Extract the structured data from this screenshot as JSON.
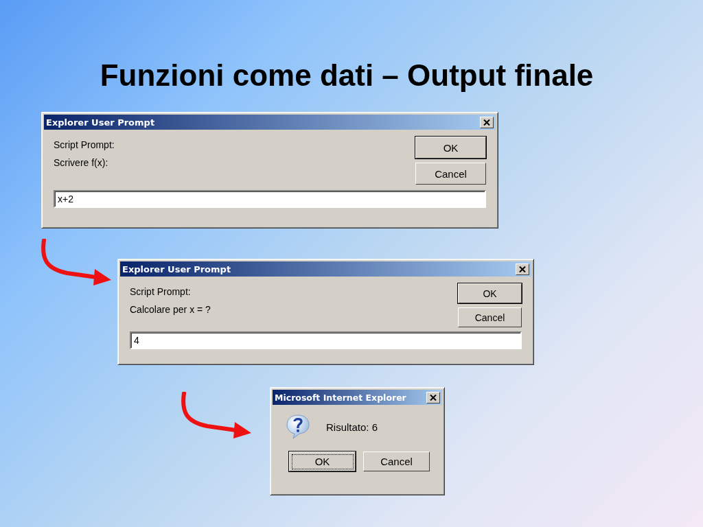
{
  "title": "Funzioni come dati – Output finale",
  "dialogs": [
    {
      "kind": "prompt",
      "title": "Explorer User Prompt",
      "lines": [
        "Script Prompt:",
        "Scrivere f(x):"
      ],
      "input": {
        "value": "x+2"
      },
      "buttons": [
        {
          "label": "OK",
          "default": true,
          "focused": false
        },
        {
          "label": "Cancel",
          "default": false,
          "focused": false
        }
      ]
    },
    {
      "kind": "prompt",
      "title": "Explorer User Prompt",
      "lines": [
        "Script Prompt:",
        "Calcolare per x = ?"
      ],
      "input": {
        "value": "4"
      },
      "buttons": [
        {
          "label": "OK",
          "default": true,
          "focused": false
        },
        {
          "label": "Cancel",
          "default": false,
          "focused": false
        }
      ]
    },
    {
      "kind": "alert",
      "title": "Microsoft Internet Explorer",
      "message": "Risultato: 6",
      "buttons": [
        {
          "label": "OK",
          "default": true,
          "focused": true
        },
        {
          "label": "Cancel",
          "default": false,
          "focused": false
        }
      ]
    }
  ]
}
